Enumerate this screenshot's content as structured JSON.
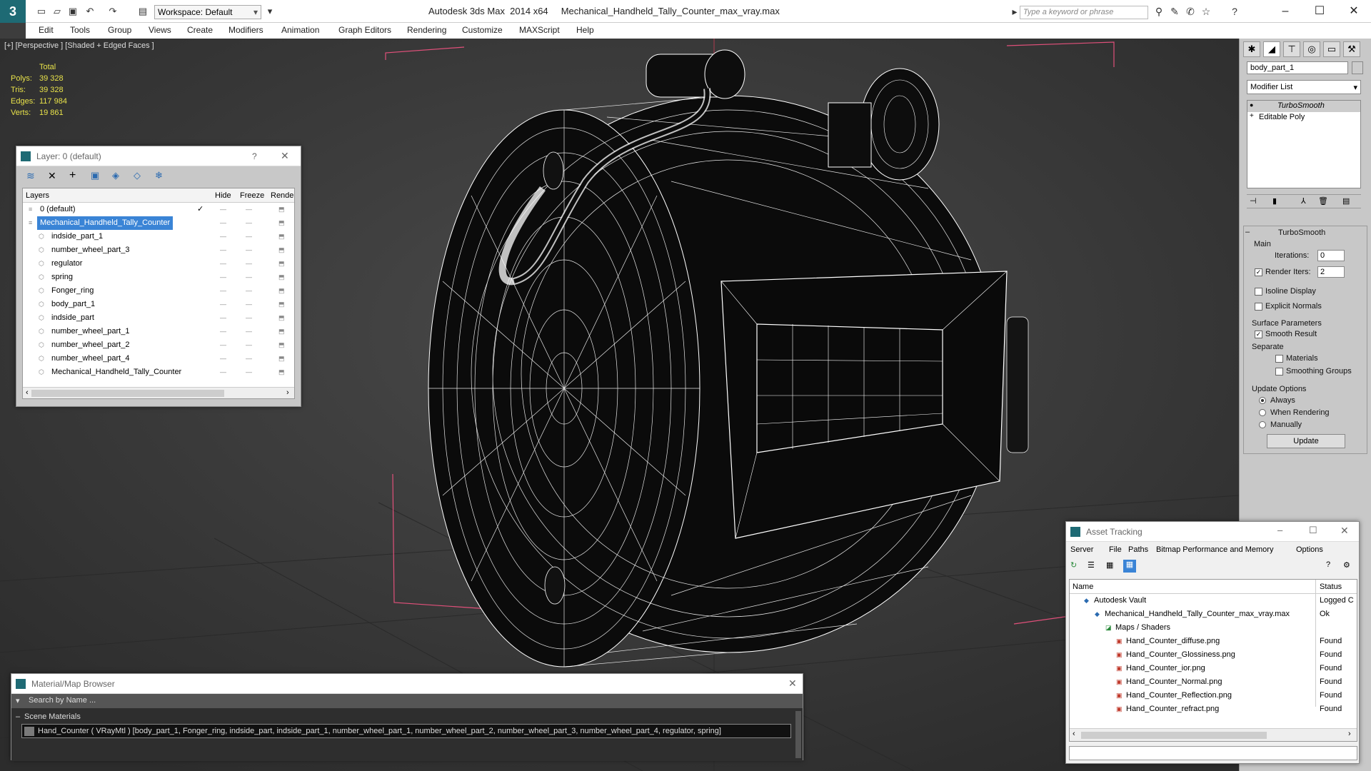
{
  "app": {
    "title": "Autodesk 3ds Max  2014 x64     Mechanical_Handheld_Tally_Counter_max_vray.max",
    "workspace": "Workspace: Default",
    "search_placeholder": "Type a keyword or phrase"
  },
  "menu": [
    "Edit",
    "Tools",
    "Group",
    "Views",
    "Create",
    "Modifiers",
    "Animation",
    "Graph Editors",
    "Rendering",
    "Customize",
    "MAXScript",
    "Help"
  ],
  "viewport": {
    "label": "[+] [Perspective ] [Shaded + Edged Faces ]",
    "stats": {
      "header": "Total",
      "rows": [
        {
          "label": "Polys:",
          "value": "39 328"
        },
        {
          "label": "Tris:",
          "value": "39 328"
        },
        {
          "label": "Edges:",
          "value": "117 984"
        },
        {
          "label": "Verts:",
          "value": "19 861"
        }
      ]
    }
  },
  "layer_dialog": {
    "title": "Layer: 0 (default)",
    "help": "?",
    "columns": [
      "Layers",
      "Hide",
      "Freeze",
      "Rende"
    ],
    "rows": [
      {
        "name": "0 (default)",
        "indent": 0,
        "selected": false,
        "checked": true
      },
      {
        "name": "Mechanical_Handheld_Tally_Counter",
        "indent": 0,
        "selected": true,
        "checked": false
      },
      {
        "name": "indside_part_1",
        "indent": 1,
        "selected": false,
        "checked": false
      },
      {
        "name": "number_wheel_part_3",
        "indent": 1,
        "selected": false,
        "checked": false
      },
      {
        "name": "regulator",
        "indent": 1,
        "selected": false,
        "checked": false
      },
      {
        "name": "spring",
        "indent": 1,
        "selected": false,
        "checked": false
      },
      {
        "name": "Fonger_ring",
        "indent": 1,
        "selected": false,
        "checked": false
      },
      {
        "name": "body_part_1",
        "indent": 1,
        "selected": false,
        "checked": false
      },
      {
        "name": "indside_part",
        "indent": 1,
        "selected": false,
        "checked": false
      },
      {
        "name": "number_wheel_part_1",
        "indent": 1,
        "selected": false,
        "checked": false
      },
      {
        "name": "number_wheel_part_2",
        "indent": 1,
        "selected": false,
        "checked": false
      },
      {
        "name": "number_wheel_part_4",
        "indent": 1,
        "selected": false,
        "checked": false
      },
      {
        "name": "Mechanical_Handheld_Tally_Counter",
        "indent": 1,
        "selected": false,
        "checked": false
      }
    ]
  },
  "command_panel": {
    "object_name": "body_part_1",
    "modifier_list": "Modifier List",
    "stack": [
      "TurboSmooth",
      "Editable Poly"
    ],
    "rollout_title": "TurboSmooth",
    "main_label": "Main",
    "iterations_label": "Iterations:",
    "iterations_value": "0",
    "render_iters_label": "Render Iters:",
    "render_iters_value": "2",
    "isoline_label": "Isoline Display",
    "explicit_normals_label": "Explicit Normals",
    "surface_params_label": "Surface Parameters",
    "smooth_result_label": "Smooth Result",
    "separate_label": "Separate",
    "materials_label": "Materials",
    "smoothing_groups_label": "Smoothing Groups",
    "update_options_label": "Update Options",
    "always_label": "Always",
    "when_rendering_label": "When Rendering",
    "manually_label": "Manually",
    "update_button": "Update"
  },
  "asset_tracking": {
    "title": "Asset Tracking",
    "menu": [
      "Server",
      "File",
      "Paths",
      "Bitmap Performance and Memory",
      "Options"
    ],
    "col_name": "Name",
    "col_status": "Status",
    "rows": [
      {
        "name": "Autodesk Vault",
        "status": "Logged C",
        "indent": 0,
        "icon": "vault-icon"
      },
      {
        "name": "Mechanical_Handheld_Tally_Counter_max_vray.max",
        "status": "Ok",
        "indent": 1,
        "icon": "max-file-icon"
      },
      {
        "name": "Maps / Shaders",
        "status": "",
        "indent": 2,
        "icon": "maps-icon"
      },
      {
        "name": "Hand_Counter_diffuse.png",
        "status": "Found",
        "indent": 3,
        "icon": "png-icon"
      },
      {
        "name": "Hand_Counter_Glossiness.png",
        "status": "Found",
        "indent": 3,
        "icon": "png-icon"
      },
      {
        "name": "Hand_Counter_ior.png",
        "status": "Found",
        "indent": 3,
        "icon": "png-icon"
      },
      {
        "name": "Hand_Counter_Normal.png",
        "status": "Found",
        "indent": 3,
        "icon": "png-icon"
      },
      {
        "name": "Hand_Counter_Reflection.png",
        "status": "Found",
        "indent": 3,
        "icon": "png-icon"
      },
      {
        "name": "Hand_Counter_refract.png",
        "status": "Found",
        "indent": 3,
        "icon": "png-icon"
      }
    ]
  },
  "material_browser": {
    "title": "Material/Map Browser",
    "search_placeholder": "Search by Name ...",
    "section": "Scene Materials",
    "material": "Hand_Counter  ( VRayMtl ) [body_part_1, Fonger_ring, indside_part, indside_part_1, number_wheel_part_1, number_wheel_part_2, number_wheel_part_3, number_wheel_part_4, regulator, spring]"
  },
  "colors": {
    "accent": "#3a84d6",
    "stats": "#e8e24a",
    "viewport_bg": "#3a3a3a",
    "wire": "#ffffff",
    "bbox": "#e0507a"
  }
}
